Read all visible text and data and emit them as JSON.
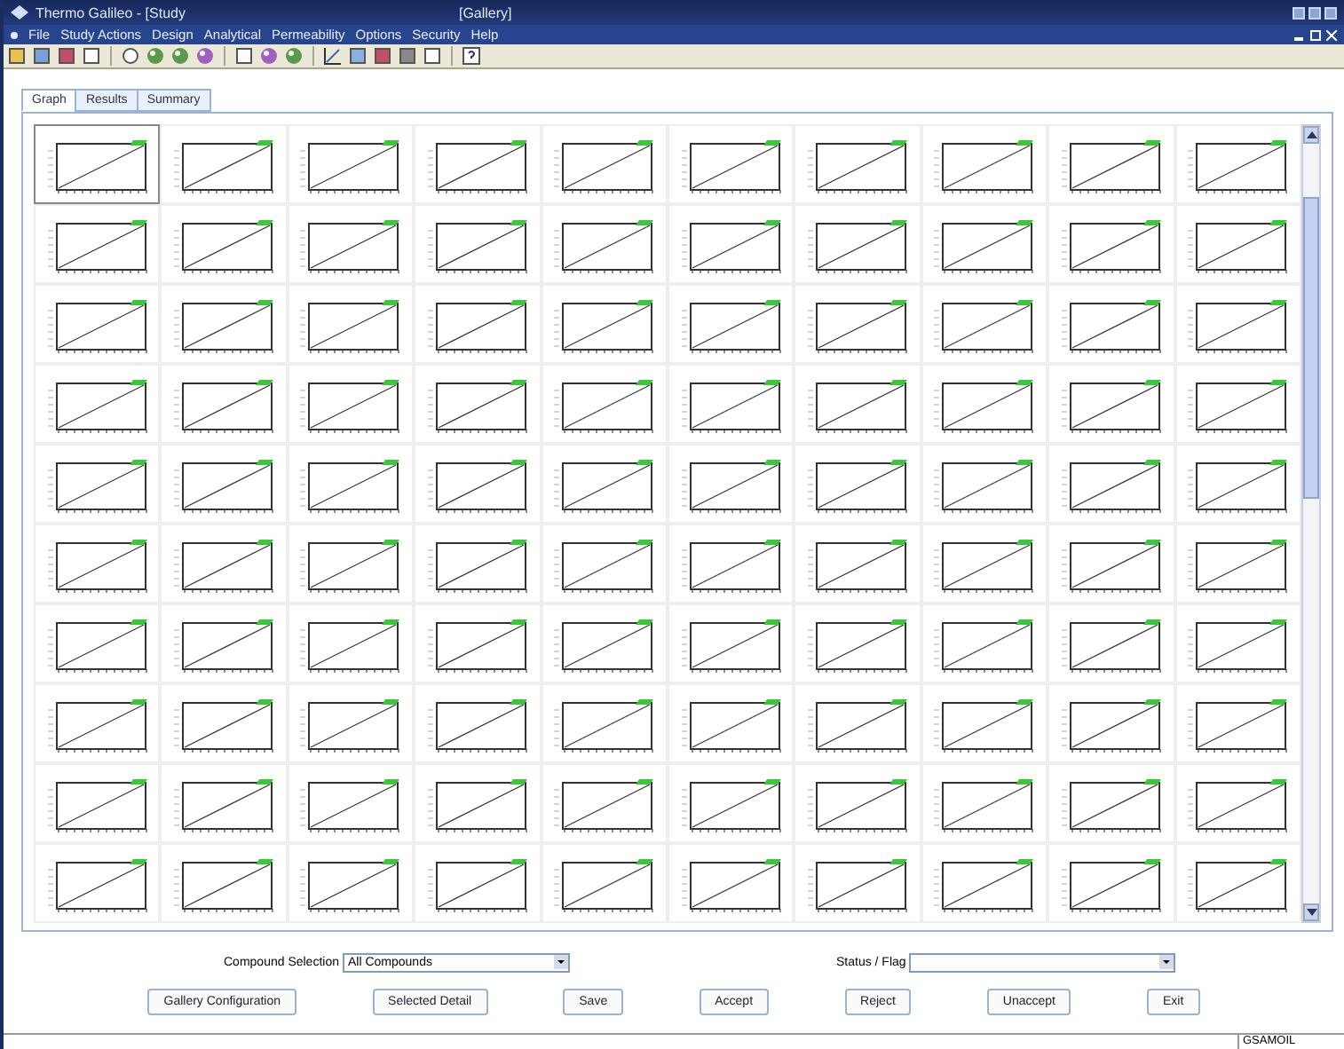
{
  "window": {
    "title": "Thermo Galileo - [Study",
    "document": "[Gallery]"
  },
  "menu": [
    "File",
    "Study Actions",
    "Design",
    "Analytical",
    "Permeability",
    "Options",
    "Security",
    "Help"
  ],
  "tabs": [
    {
      "label": "Graph",
      "selected": true
    },
    {
      "label": "Results",
      "selected": false
    },
    {
      "label": "Summary",
      "selected": false
    }
  ],
  "gallery": {
    "rows": [
      {
        "cells": [
          {
            "selected": true
          },
          {
            "selected": false
          },
          {
            "selected": false
          },
          {
            "selected": false
          },
          {
            "selected": false
          },
          {
            "selected": false
          },
          {
            "selected": false
          },
          {
            "selected": false
          },
          {
            "selected": false
          },
          {
            "selected": false
          }
        ]
      },
      {
        "cells": [
          {
            "selected": false
          },
          {
            "selected": false
          },
          {
            "selected": false
          },
          {
            "selected": false
          },
          {
            "selected": false
          },
          {
            "selected": false
          },
          {
            "selected": false
          },
          {
            "selected": false
          },
          {
            "selected": false
          },
          {
            "selected": false
          }
        ]
      },
      {
        "cells": [
          {
            "selected": false
          },
          {
            "selected": false
          },
          {
            "selected": false
          },
          {
            "selected": false
          },
          {
            "selected": false
          },
          {
            "selected": false
          },
          {
            "selected": false
          },
          {
            "selected": false
          },
          {
            "selected": false
          },
          {
            "selected": false
          }
        ]
      },
      {
        "cells": [
          {
            "selected": false
          },
          {
            "selected": false
          },
          {
            "selected": false
          },
          {
            "selected": false
          },
          {
            "selected": false
          },
          {
            "selected": false
          },
          {
            "selected": false
          },
          {
            "selected": false
          },
          {
            "selected": false
          },
          {
            "selected": false
          }
        ]
      },
      {
        "cells": [
          {
            "selected": false
          },
          {
            "selected": false
          },
          {
            "selected": false
          },
          {
            "selected": false
          },
          {
            "selected": false
          },
          {
            "selected": false
          },
          {
            "selected": false
          },
          {
            "selected": false
          },
          {
            "selected": false
          },
          {
            "selected": false
          }
        ]
      },
      {
        "cells": [
          {
            "selected": false
          },
          {
            "selected": false
          },
          {
            "selected": false
          },
          {
            "selected": false
          },
          {
            "selected": false
          },
          {
            "selected": false
          },
          {
            "selected": false
          },
          {
            "selected": false
          },
          {
            "selected": false
          },
          {
            "selected": false
          }
        ]
      },
      {
        "cells": [
          {
            "selected": false
          },
          {
            "selected": false
          },
          {
            "selected": false
          },
          {
            "selected": false
          },
          {
            "selected": false
          },
          {
            "selected": false
          },
          {
            "selected": false
          },
          {
            "selected": false
          },
          {
            "selected": false
          },
          {
            "selected": false
          }
        ]
      },
      {
        "cells": [
          {
            "selected": false
          },
          {
            "selected": false
          },
          {
            "selected": false
          },
          {
            "selected": false
          },
          {
            "selected": false
          },
          {
            "selected": false
          },
          {
            "selected": false
          },
          {
            "selected": false
          },
          {
            "selected": false
          },
          {
            "selected": false
          }
        ]
      },
      {
        "cells": [
          {
            "selected": false
          },
          {
            "selected": false
          },
          {
            "selected": false
          },
          {
            "selected": false
          },
          {
            "selected": false
          },
          {
            "selected": false
          },
          {
            "selected": false
          },
          {
            "selected": false
          },
          {
            "selected": false
          },
          {
            "selected": false
          }
        ]
      },
      {
        "cells": [
          {
            "selected": false
          },
          {
            "selected": false
          },
          {
            "selected": false
          },
          {
            "selected": false
          },
          {
            "selected": false
          },
          {
            "selected": false
          },
          {
            "selected": false
          },
          {
            "selected": false
          },
          {
            "selected": false
          },
          {
            "selected": false
          }
        ]
      }
    ]
  },
  "filters": [
    {
      "label": "Compound Selection",
      "value": "All Compounds"
    },
    {
      "label": "Status / Flag"
    }
  ],
  "buttons": [
    "Gallery Configuration",
    "Selected Detail",
    "Save",
    "Accept",
    "Reject",
    "Unaccept",
    "Exit"
  ],
  "status_bar": {
    "user": "GSAMOIL"
  }
}
